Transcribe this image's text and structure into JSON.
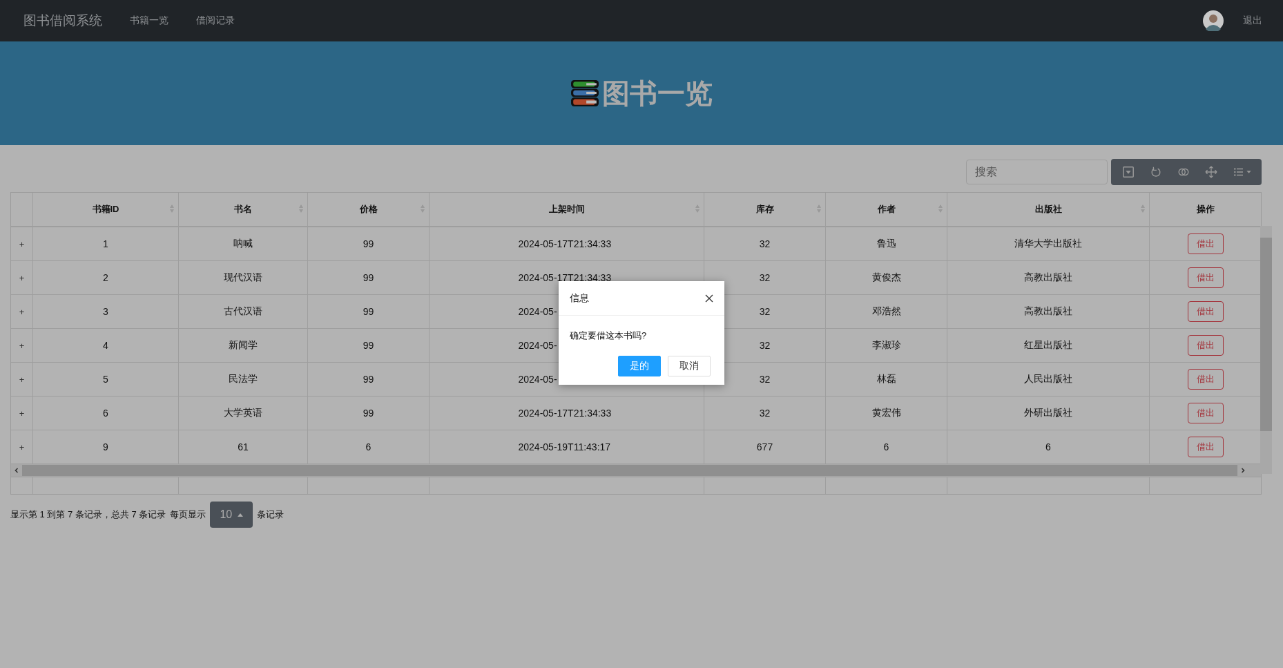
{
  "navbar": {
    "brand": "图书借阅系统",
    "links": [
      {
        "label": "书籍一览"
      },
      {
        "label": "借阅记录"
      }
    ],
    "logout": "退出"
  },
  "header": {
    "title": "图书一览"
  },
  "search": {
    "placeholder": "搜索"
  },
  "table": {
    "columns": [
      {},
      {
        "label": "书籍ID",
        "sortable": true
      },
      {
        "label": "书名",
        "sortable": true
      },
      {
        "label": "价格",
        "sortable": true
      },
      {
        "label": "上架时间",
        "sortable": true
      },
      {
        "label": "库存",
        "sortable": true
      },
      {
        "label": "作者",
        "sortable": true
      },
      {
        "label": "出版社",
        "sortable": true
      },
      {
        "label": "操作"
      }
    ],
    "rows": [
      {
        "cells": [
          "+",
          "1",
          "呐喊",
          "99",
          "2024-05-17T21:34:33",
          "32",
          "鲁迅",
          "清华大学出版社",
          "借出"
        ]
      },
      {
        "cells": [
          "+",
          "2",
          "现代汉语",
          "99",
          "2024-05-17T21:34:33",
          "32",
          "黄俊杰",
          "高教出版社",
          "借出"
        ]
      },
      {
        "cells": [
          "+",
          "3",
          "古代汉语",
          "99",
          "2024-05-",
          "32",
          "邓浩然",
          "高教出版社",
          "借出"
        ]
      },
      {
        "cells": [
          "+",
          "4",
          "新闻学",
          "99",
          "2024-05-",
          "32",
          "李淑珍",
          "红星出版社",
          "借出"
        ]
      },
      {
        "cells": [
          "+",
          "5",
          "民法学",
          "99",
          "2024-05-",
          "32",
          "林磊",
          "人民出版社",
          "借出"
        ]
      },
      {
        "cells": [
          "+",
          "6",
          "大学英语",
          "99",
          "2024-05-17T21:34:33",
          "32",
          "黄宏伟",
          "外研出版社",
          "借出"
        ]
      },
      {
        "cells": [
          "+",
          "9",
          "61",
          "6",
          "2024-05-19T11:43:17",
          "677",
          "6",
          "6",
          "借出"
        ]
      }
    ]
  },
  "pagination": {
    "summary": "显示第 1 到第 7 条记录，总共 7 条记录",
    "per_page_label": "每页显示",
    "page_size": "10",
    "suffix": "条记录"
  },
  "dialog": {
    "title": "信息",
    "message": "确定要借这本书吗?",
    "confirm": "是的",
    "cancel": "取消"
  }
}
